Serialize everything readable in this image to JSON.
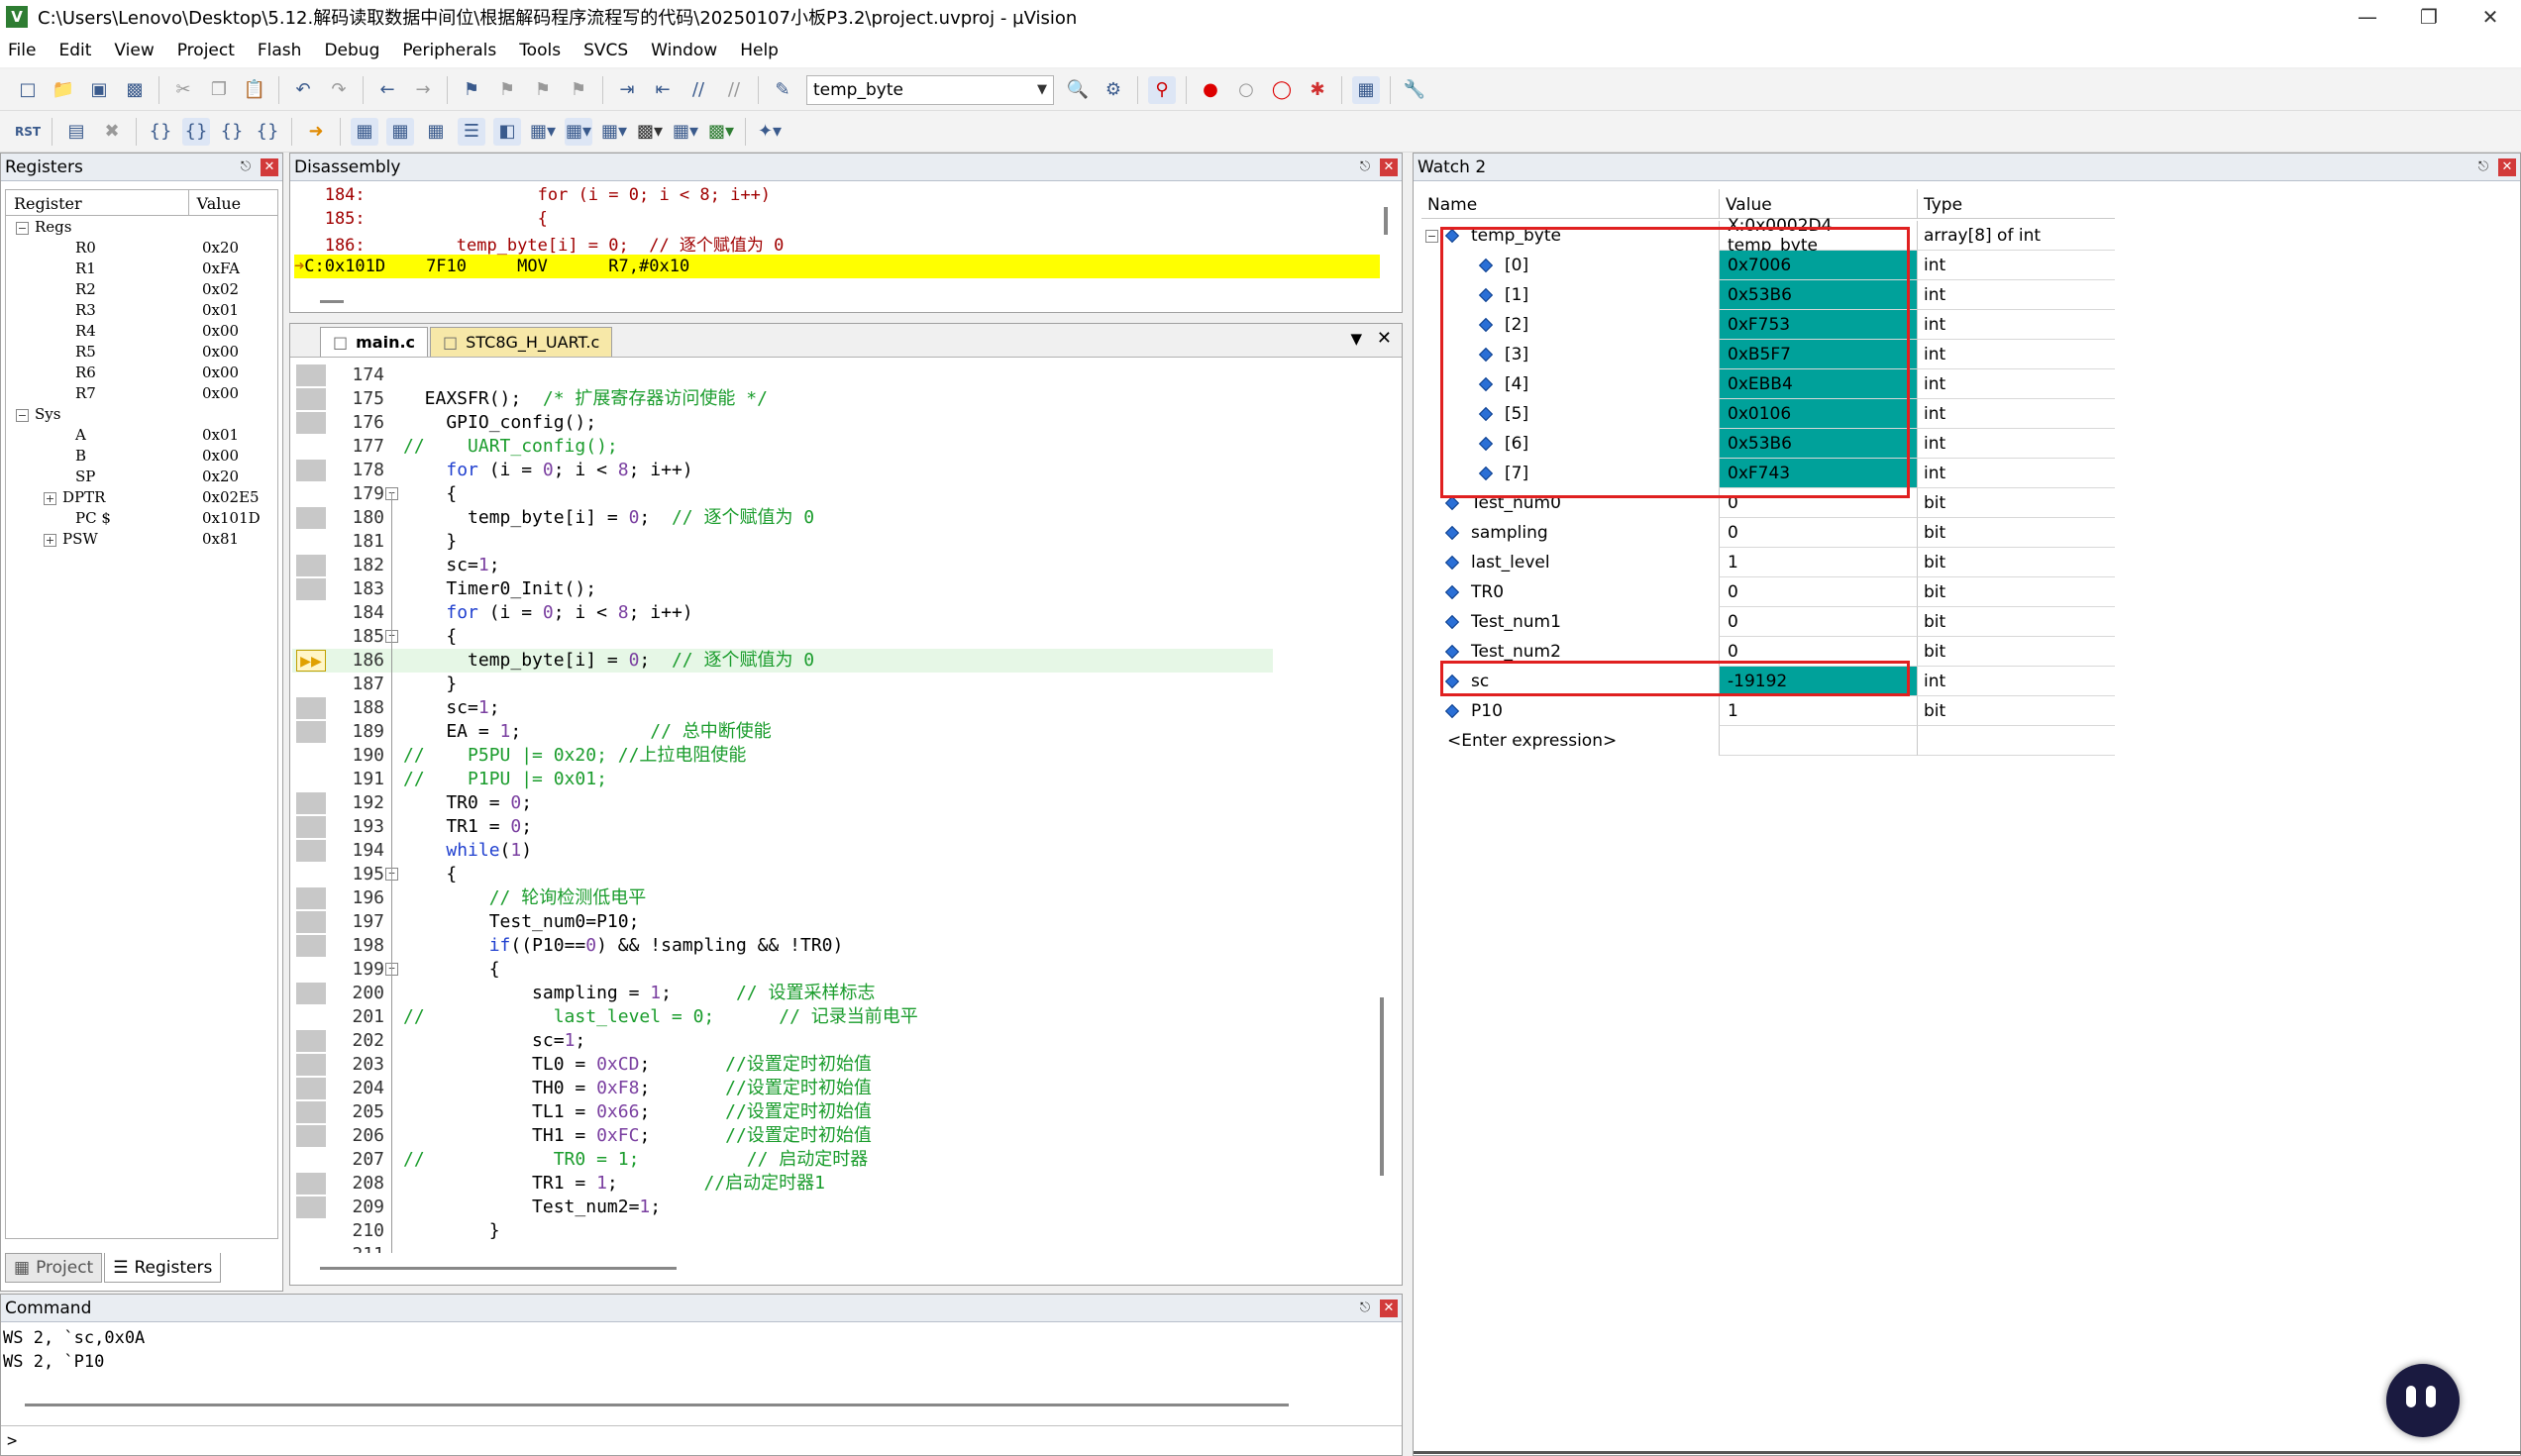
{
  "window": {
    "title": "C:\\Users\\Lenovo\\Desktop\\5.12.解码读取数据中间位\\根据解码程序流程写的代码\\20250107小板P3.2\\project.uvproj - µVision",
    "app_icon": "V"
  },
  "menu": [
    "File",
    "Edit",
    "View",
    "Project",
    "Flash",
    "Debug",
    "Peripherals",
    "Tools",
    "SVCS",
    "Window",
    "Help"
  ],
  "toolbar": {
    "combo_value": "temp_byte"
  },
  "registers": {
    "title": "Registers",
    "col_register": "Register",
    "col_value": "Value",
    "rows": [
      {
        "name": "Regs",
        "value": "",
        "level": 0,
        "toggle": "−"
      },
      {
        "name": "R0",
        "value": "0x20",
        "level": 2,
        "toggle": ""
      },
      {
        "name": "R1",
        "value": "0xFA",
        "level": 2,
        "toggle": ""
      },
      {
        "name": "R2",
        "value": "0x02",
        "level": 2,
        "toggle": ""
      },
      {
        "name": "R3",
        "value": "0x01",
        "level": 2,
        "toggle": ""
      },
      {
        "name": "R4",
        "value": "0x00",
        "level": 2,
        "toggle": ""
      },
      {
        "name": "R5",
        "value": "0x00",
        "level": 2,
        "toggle": ""
      },
      {
        "name": "R6",
        "value": "0x00",
        "level": 2,
        "toggle": ""
      },
      {
        "name": "R7",
        "value": "0x00",
        "level": 2,
        "toggle": ""
      },
      {
        "name": "Sys",
        "value": "",
        "level": 0,
        "toggle": "−"
      },
      {
        "name": "A",
        "value": "0x01",
        "level": 2,
        "toggle": ""
      },
      {
        "name": "B",
        "value": "0x00",
        "level": 2,
        "toggle": ""
      },
      {
        "name": "SP",
        "value": "0x20",
        "level": 2,
        "toggle": ""
      },
      {
        "name": "DPTR",
        "value": "0x02E5",
        "level": 1,
        "toggle": "+"
      },
      {
        "name": "PC $",
        "value": "0x101D",
        "level": 2,
        "toggle": ""
      },
      {
        "name": "PSW",
        "value": "0x81",
        "level": 1,
        "toggle": "+"
      }
    ],
    "tabs": [
      "Project",
      "Registers"
    ]
  },
  "disassembly": {
    "title": "Disassembly",
    "lines": [
      "   184:                 for (i = 0; i < 8; i++)",
      "   185:                 {",
      "   186:         temp_byte[i] = 0;  // 逐个赋值为 0"
    ],
    "current": "C:0x101D    7F10     MOV      R7,#0x10"
  },
  "editor": {
    "tabs": [
      "main.c",
      "STC8G_H_UART.c"
    ],
    "lines": [
      {
        "n": "174",
        "t": ""
      },
      {
        "n": "175",
        "t": "  EAXSFR();  /* 扩展寄存器访问使能 */"
      },
      {
        "n": "176",
        "t": "    GPIO_config();"
      },
      {
        "n": "177",
        "t": "//    UART_config();"
      },
      {
        "n": "178",
        "t": "    for (i = 0; i < 8; i++)"
      },
      {
        "n": "179",
        "t": "    {"
      },
      {
        "n": "180",
        "t": "      temp_byte[i] = 0;  // 逐个赋值为 0"
      },
      {
        "n": "181",
        "t": "    }"
      },
      {
        "n": "182",
        "t": "    sc=1;"
      },
      {
        "n": "183",
        "t": "    Timer0_Init();"
      },
      {
        "n": "184",
        "t": "    for (i = 0; i < 8; i++)"
      },
      {
        "n": "185",
        "t": "    {"
      },
      {
        "n": "186",
        "t": "      temp_byte[i] = 0;  // 逐个赋值为 0"
      },
      {
        "n": "187",
        "t": "    }"
      },
      {
        "n": "188",
        "t": "    sc=1;"
      },
      {
        "n": "189",
        "t": "    EA = 1;            // 总中断使能"
      },
      {
        "n": "190",
        "t": "//    P5PU |= 0x20; //上拉电阻使能"
      },
      {
        "n": "191",
        "t": "//    P1PU |= 0x01;"
      },
      {
        "n": "192",
        "t": "    TR0 = 0;"
      },
      {
        "n": "193",
        "t": "    TR1 = 0;"
      },
      {
        "n": "194",
        "t": "    while(1)"
      },
      {
        "n": "195",
        "t": "    {"
      },
      {
        "n": "196",
        "t": "        // 轮询检测低电平"
      },
      {
        "n": "197",
        "t": "        Test_num0=P10;"
      },
      {
        "n": "198",
        "t": "        if((P10==0) && !sampling && !TR0)"
      },
      {
        "n": "199",
        "t": "        {"
      },
      {
        "n": "200",
        "t": "            sampling = 1;      // 设置采样标志"
      },
      {
        "n": "201",
        "t": "//            last_level = 0;      // 记录当前电平"
      },
      {
        "n": "202",
        "t": "            sc=1;"
      },
      {
        "n": "203",
        "t": "            TL0 = 0xCD;       //设置定时初始值"
      },
      {
        "n": "204",
        "t": "            TH0 = 0xF8;       //设置定时初始值"
      },
      {
        "n": "205",
        "t": "            TL1 = 0x66;       //设置定时初始值"
      },
      {
        "n": "206",
        "t": "            TH1 = 0xFC;       //设置定时初始值"
      },
      {
        "n": "207",
        "t": "//            TR0 = 1;          // 启动定时器"
      },
      {
        "n": "208",
        "t": "            TR1 = 1;        //启动定时器1"
      },
      {
        "n": "209",
        "t": "            Test_num2=1;"
      },
      {
        "n": "210",
        "t": "        }"
      },
      {
        "n": "211",
        "t": ""
      }
    ]
  },
  "watch": {
    "title": "Watch 2",
    "col_name": "Name",
    "col_value": "Value",
    "col_type": "Type",
    "rows": [
      {
        "name": "temp_byte",
        "value": "X:0x0002D4 temp_byte",
        "type": "array[8] of int",
        "indent": 0,
        "hl": false,
        "toggle": "−"
      },
      {
        "name": "[0]",
        "value": "0x7006",
        "type": "int",
        "indent": 1,
        "hl": true
      },
      {
        "name": "[1]",
        "value": "0x53B6",
        "type": "int",
        "indent": 1,
        "hl": true
      },
      {
        "name": "[2]",
        "value": "0xF753",
        "type": "int",
        "indent": 1,
        "hl": true
      },
      {
        "name": "[3]",
        "value": "0xB5F7",
        "type": "int",
        "indent": 1,
        "hl": true
      },
      {
        "name": "[4]",
        "value": "0xEBB4",
        "type": "int",
        "indent": 1,
        "hl": true
      },
      {
        "name": "[5]",
        "value": "0x0106",
        "type": "int",
        "indent": 1,
        "hl": true
      },
      {
        "name": "[6]",
        "value": "0x53B6",
        "type": "int",
        "indent": 1,
        "hl": true
      },
      {
        "name": "[7]",
        "value": "0xF743",
        "type": "int",
        "indent": 1,
        "hl": true
      },
      {
        "name": "Test_num0",
        "value": "0",
        "type": "bit",
        "indent": 0,
        "hl": false
      },
      {
        "name": "sampling",
        "value": "0",
        "type": "bit",
        "indent": 0,
        "hl": false
      },
      {
        "name": "last_level",
        "value": "1",
        "type": "bit",
        "indent": 0,
        "hl": false
      },
      {
        "name": "TR0",
        "value": "0",
        "type": "bit",
        "indent": 0,
        "hl": false
      },
      {
        "name": "Test_num1",
        "value": "0",
        "type": "bit",
        "indent": 0,
        "hl": false
      },
      {
        "name": "Test_num2",
        "value": "0",
        "type": "bit",
        "indent": 0,
        "hl": false
      },
      {
        "name": "sc",
        "value": "-19192",
        "type": "int",
        "indent": 0,
        "hl": true
      },
      {
        "name": "P10",
        "value": "1",
        "type": "bit",
        "indent": 0,
        "hl": false
      }
    ],
    "enter_expression": "<Enter expression>",
    "annotation_color": "#e02020",
    "highlight_color": "#00a19a"
  },
  "command": {
    "title": "Command",
    "lines": [
      "WS 2, `sc,0x0A",
      "WS 2, `P10"
    ],
    "prompt": ">"
  }
}
